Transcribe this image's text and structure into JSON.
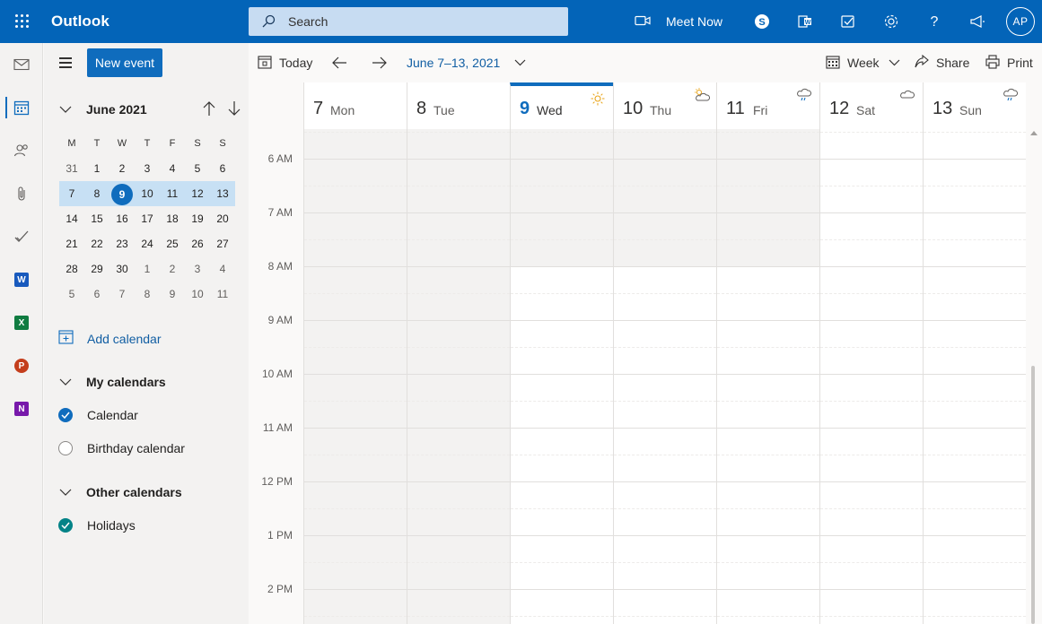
{
  "app": {
    "name": "Outlook"
  },
  "search": {
    "placeholder": "Search"
  },
  "topbar": {
    "meet_now_label": "Meet Now",
    "avatar_initials": "AP"
  },
  "toolbar": {
    "new_event_label": "New event",
    "today_label": "Today",
    "date_range": "June 7–13, 2021",
    "view_label": "Week",
    "share_label": "Share",
    "print_label": "Print"
  },
  "mini_calendar": {
    "title": "June 2021",
    "weekdays": [
      "M",
      "T",
      "W",
      "T",
      "F",
      "S",
      "S"
    ],
    "weeks": [
      [
        "31",
        "1",
        "2",
        "3",
        "4",
        "5",
        "6"
      ],
      [
        "7",
        "8",
        "9",
        "10",
        "11",
        "12",
        "13"
      ],
      [
        "14",
        "15",
        "16",
        "17",
        "18",
        "19",
        "20"
      ],
      [
        "21",
        "22",
        "23",
        "24",
        "25",
        "26",
        "27"
      ],
      [
        "28",
        "29",
        "30",
        "1",
        "2",
        "3",
        "4"
      ],
      [
        "5",
        "6",
        "7",
        "8",
        "9",
        "10",
        "11"
      ]
    ],
    "selected_week_index": 1,
    "today": "9"
  },
  "sidebar": {
    "add_calendar_label": "Add calendar",
    "my_calendars_label": "My calendars",
    "calendar_label": "Calendar",
    "birthday_calendar_label": "Birthday calendar",
    "other_calendars_label": "Other calendars",
    "holidays_label": "Holidays"
  },
  "week": {
    "days": [
      {
        "num": "7",
        "name": "Mon",
        "weather": ""
      },
      {
        "num": "8",
        "name": "Tue",
        "weather": ""
      },
      {
        "num": "9",
        "name": "Wed",
        "weather": "sun-icon"
      },
      {
        "num": "10",
        "name": "Thu",
        "weather": "partly-cloudy-icon"
      },
      {
        "num": "11",
        "name": "Fri",
        "weather": "rain-cloud-icon"
      },
      {
        "num": "12",
        "name": "Sat",
        "weather": "cloud-icon"
      },
      {
        "num": "13",
        "name": "Sun",
        "weather": "rain-cloud-icon"
      }
    ],
    "today_index": 2,
    "times": [
      "6 AM",
      "7 AM",
      "8 AM",
      "9 AM",
      "10 AM",
      "11 AM",
      "12 PM",
      "1 PM",
      "2 PM"
    ]
  },
  "colors": {
    "accent": "#0f6cbd",
    "topbar": "#0364b8",
    "selected_week": "#c7e0f4",
    "holidays_check": "#038387"
  }
}
